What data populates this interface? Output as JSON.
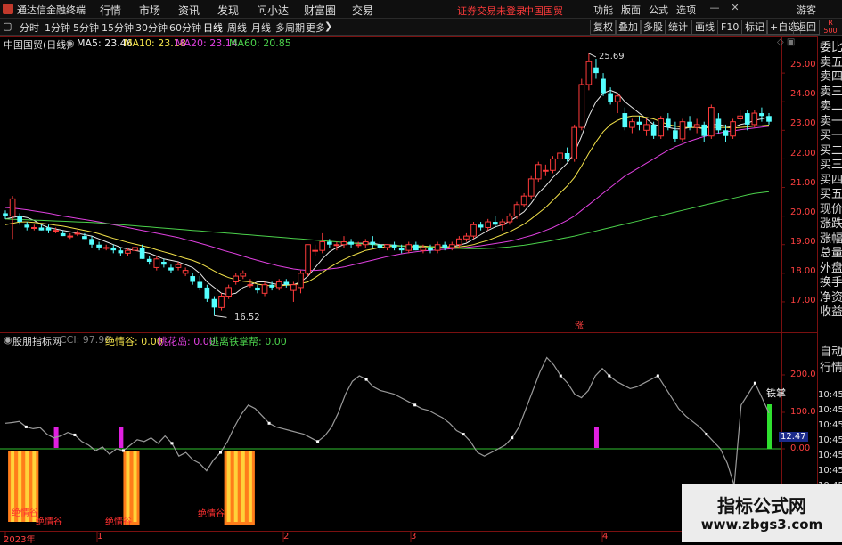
{
  "app": {
    "name": "通达信金融终端"
  },
  "menu": [
    "行情",
    "市场",
    "资讯",
    "发现",
    "问小达",
    "财富圈",
    "交易"
  ],
  "warning": {
    "login": "证券交易未登录",
    "stock": "中国国贸"
  },
  "right_menu": [
    "功能",
    "版面",
    "公式",
    "选项"
  ],
  "guest": "游客",
  "toolbar": {
    "periods": [
      "分时",
      "1分钟",
      "5分钟",
      "15分钟",
      "30分钟",
      "60分钟",
      "日线",
      "周线",
      "月线",
      "多周期",
      "更多"
    ],
    "active": "日线",
    "right": [
      "复权",
      "叠加",
      "多股",
      "统计",
      "画线",
      "F10",
      "标记",
      "+自选",
      "返回"
    ]
  },
  "main_chart": {
    "title": "中国国贸(日线)",
    "ma": [
      {
        "label": "MA5: 23.46",
        "color": "#e8e8e8"
      },
      {
        "label": "MA10: 23.18",
        "color": "#f3e24a"
      },
      {
        "label": "MA20: 23.14",
        "color": "#e040e0"
      },
      {
        "label": "MA60: 20.85",
        "color": "#4bd14b"
      }
    ],
    "high_label": "25.69",
    "low_label": "16.52",
    "badge": "涨",
    "yticks": [
      "25.00",
      "24.00",
      "23.00",
      "22.00",
      "21.00",
      "20.00",
      "19.00",
      "18.00",
      "17.00"
    ]
  },
  "indicator": {
    "name": "股朋指标网",
    "values": [
      {
        "label": "CCI: 97.90",
        "color": "#808080"
      },
      {
        "label": "绝情谷: 0.00",
        "color": "#f3e24a"
      },
      {
        "label": "桃花岛: 0.00",
        "color": "#e040e0"
      },
      {
        "label": "逃离铁掌帮: 0.00",
        "color": "#4bd14b"
      }
    ],
    "yticks": [
      "200.0",
      "100.0",
      "0.00"
    ],
    "current_value": "12.47",
    "side_label": "铁掌",
    "signal_label": "绝情谷"
  },
  "date_axis": [
    "2023年",
    "1",
    "2",
    "3",
    "4"
  ],
  "right_panel": [
    "委比",
    "卖五",
    "卖四",
    "卖三",
    "卖二",
    "卖一",
    "买一",
    "买二",
    "买三",
    "买四",
    "买五",
    "现价",
    "涨跌",
    "涨幅",
    "总量",
    "外盘",
    "换手",
    "净资",
    "收益"
  ],
  "right_panel_bottom": [
    "自动",
    "行情"
  ],
  "times": [
    "10:45",
    "10:45",
    "10:45",
    "10:45",
    "10:45",
    "10:45",
    "10:45"
  ],
  "r_badge": "R",
  "r_badge_num": "500",
  "watermark": {
    "line1": "指标公式网",
    "line2": "www.zbgs3.com"
  },
  "chart_data": {
    "type": "candlestick",
    "ylim": [
      16.5,
      26.0
    ],
    "colors": {
      "up": "#ff3b3b",
      "down": "#54ffff"
    },
    "candles": [
      [
        20.1,
        20.2,
        19.9,
        20.0
      ],
      [
        20.0,
        20.7,
        19.2,
        20.6
      ],
      [
        20.0,
        20.1,
        19.7,
        19.8
      ],
      [
        19.7,
        19.8,
        19.5,
        19.6
      ],
      [
        19.6,
        19.7,
        19.5,
        19.6
      ],
      [
        19.6,
        19.7,
        19.5,
        19.5
      ],
      [
        19.6,
        19.7,
        19.4,
        19.5
      ],
      [
        19.5,
        19.6,
        19.4,
        19.5
      ],
      [
        19.4,
        19.5,
        19.3,
        19.3
      ],
      [
        19.3,
        19.4,
        19.2,
        19.3
      ],
      [
        19.4,
        19.5,
        19.3,
        19.4
      ],
      [
        19.3,
        19.4,
        19.2,
        19.2
      ],
      [
        19.2,
        19.3,
        18.9,
        19.0
      ],
      [
        19.0,
        19.1,
        18.8,
        18.9
      ],
      [
        18.9,
        19.0,
        18.8,
        18.9
      ],
      [
        18.9,
        19.0,
        18.7,
        18.8
      ],
      [
        18.8,
        18.9,
        18.6,
        18.7
      ],
      [
        18.7,
        18.9,
        18.6,
        18.8
      ],
      [
        18.8,
        19.0,
        18.7,
        18.9
      ],
      [
        18.9,
        19.0,
        18.5,
        18.5
      ],
      [
        18.5,
        18.6,
        18.3,
        18.4
      ],
      [
        18.2,
        18.6,
        18.1,
        18.5
      ],
      [
        18.4,
        18.5,
        18.2,
        18.3
      ],
      [
        18.2,
        18.3,
        18.0,
        18.1
      ],
      [
        18.2,
        18.4,
        18.1,
        18.3
      ],
      [
        18.0,
        18.2,
        17.9,
        18.1
      ],
      [
        17.9,
        18.0,
        17.6,
        17.7
      ],
      [
        17.7,
        17.9,
        17.4,
        17.5
      ],
      [
        17.5,
        17.6,
        17.0,
        17.1
      ],
      [
        17.1,
        17.2,
        16.52,
        16.8
      ],
      [
        16.8,
        17.3,
        16.7,
        17.2
      ],
      [
        17.2,
        17.6,
        17.1,
        17.5
      ],
      [
        17.7,
        18.0,
        17.6,
        17.9
      ],
      [
        17.9,
        18.1,
        17.8,
        18.0
      ],
      [
        17.6,
        17.8,
        17.5,
        17.6
      ],
      [
        17.5,
        17.6,
        17.3,
        17.4
      ],
      [
        17.3,
        17.7,
        17.2,
        17.6
      ],
      [
        17.6,
        17.7,
        17.4,
        17.5
      ],
      [
        17.5,
        17.8,
        17.4,
        17.7
      ],
      [
        17.7,
        17.8,
        17.5,
        17.6
      ],
      [
        17.4,
        17.7,
        17.0,
        17.6
      ],
      [
        17.5,
        18.1,
        17.3,
        18.0
      ],
      [
        18.0,
        19.0,
        17.9,
        19.0
      ],
      [
        18.8,
        19.0,
        18.6,
        18.8
      ],
      [
        18.8,
        19.4,
        18.7,
        19.1
      ],
      [
        19.1,
        19.2,
        18.9,
        19.0
      ],
      [
        19.0,
        19.1,
        18.8,
        19.0
      ],
      [
        19.0,
        19.3,
        18.9,
        19.1
      ],
      [
        19.1,
        19.2,
        18.9,
        19.0
      ],
      [
        19.0,
        19.1,
        18.9,
        19.0
      ],
      [
        19.0,
        19.2,
        18.9,
        19.1
      ],
      [
        19.1,
        19.3,
        18.9,
        19.0
      ],
      [
        19.0,
        19.1,
        18.8,
        18.9
      ],
      [
        18.9,
        19.0,
        18.8,
        19.0
      ],
      [
        19.0,
        19.1,
        18.8,
        18.9
      ],
      [
        18.9,
        19.0,
        18.7,
        18.8
      ],
      [
        18.8,
        19.1,
        18.7,
        19.0
      ],
      [
        19.0,
        19.1,
        18.8,
        18.8
      ],
      [
        18.8,
        19.0,
        18.7,
        18.9
      ],
      [
        18.9,
        19.0,
        18.7,
        18.8
      ],
      [
        18.8,
        19.1,
        18.7,
        19.0
      ],
      [
        19.0,
        19.1,
        18.8,
        18.9
      ],
      [
        18.9,
        19.1,
        18.8,
        19.0
      ],
      [
        19.0,
        19.3,
        18.9,
        19.2
      ],
      [
        19.2,
        19.4,
        19.1,
        19.3
      ],
      [
        19.3,
        19.8,
        19.2,
        19.7
      ],
      [
        19.7,
        19.8,
        19.5,
        19.6
      ],
      [
        19.6,
        19.9,
        19.5,
        19.8
      ],
      [
        19.8,
        20.0,
        19.6,
        19.7
      ],
      [
        19.7,
        19.9,
        19.5,
        19.8
      ],
      [
        19.8,
        20.1,
        19.7,
        20.0
      ],
      [
        20.0,
        20.5,
        19.9,
        20.4
      ],
      [
        20.4,
        20.8,
        20.3,
        20.7
      ],
      [
        20.7,
        21.4,
        20.6,
        21.3
      ],
      [
        21.3,
        21.9,
        21.2,
        21.8
      ],
      [
        21.6,
        21.8,
        21.4,
        21.6
      ],
      [
        21.6,
        22.1,
        21.5,
        22.0
      ],
      [
        22.0,
        22.3,
        21.8,
        22.2
      ],
      [
        22.2,
        22.4,
        21.9,
        22.0
      ],
      [
        22.0,
        23.2,
        21.9,
        23.1
      ],
      [
        23.1,
        24.8,
        23.0,
        24.6
      ],
      [
        24.6,
        25.69,
        24.4,
        25.4
      ],
      [
        25.2,
        25.5,
        24.8,
        25.0
      ],
      [
        24.8,
        25.0,
        24.2,
        24.3
      ],
      [
        24.3,
        24.5,
        23.9,
        24.0
      ],
      [
        24.0,
        24.3,
        23.6,
        24.2
      ],
      [
        23.6,
        23.8,
        23.0,
        23.1
      ],
      [
        23.1,
        23.4,
        22.9,
        23.3
      ],
      [
        23.3,
        23.5,
        23.0,
        23.2
      ],
      [
        23.0,
        23.4,
        22.8,
        23.2
      ],
      [
        23.2,
        23.3,
        22.7,
        22.8
      ],
      [
        22.8,
        23.5,
        22.7,
        23.4
      ],
      [
        23.4,
        23.6,
        23.0,
        23.1
      ],
      [
        23.0,
        23.3,
        22.6,
        22.7
      ],
      [
        22.7,
        23.4,
        22.6,
        23.3
      ],
      [
        23.3,
        23.5,
        23.0,
        23.1
      ],
      [
        23.1,
        23.4,
        22.9,
        23.2
      ],
      [
        23.2,
        23.3,
        22.6,
        22.8
      ],
      [
        22.8,
        23.9,
        22.7,
        23.8
      ],
      [
        23.4,
        23.6,
        22.9,
        23.0
      ],
      [
        23.0,
        23.2,
        22.6,
        22.8
      ],
      [
        22.8,
        23.4,
        22.7,
        23.3
      ],
      [
        23.4,
        23.7,
        23.3,
        23.5
      ],
      [
        23.6,
        23.7,
        23.0,
        23.2
      ],
      [
        23.2,
        23.7,
        23.1,
        23.6
      ],
      [
        23.6,
        23.8,
        23.3,
        23.5
      ],
      [
        23.5,
        23.6,
        23.2,
        23.3
      ]
    ],
    "ma_lines": [
      {
        "name": "MA5",
        "values": [
          19.9,
          19.95,
          20.0,
          19.95,
          19.85,
          19.7,
          19.6,
          19.55,
          19.5,
          19.45,
          19.4,
          19.35,
          19.3,
          19.2,
          19.1,
          19.0,
          18.9,
          18.85,
          18.8,
          18.75,
          18.7,
          18.6,
          18.5,
          18.45,
          18.4,
          18.3,
          18.2,
          18.0,
          17.7,
          17.5,
          17.3,
          17.25,
          17.3,
          17.5,
          17.6,
          17.7,
          17.7,
          17.65,
          17.6,
          17.6,
          17.6,
          17.7,
          17.9,
          18.2,
          18.5,
          18.75,
          18.9,
          19.0,
          19.05,
          19.05,
          19.05,
          19.05,
          19.0,
          19.0,
          18.98,
          18.95,
          18.92,
          18.92,
          18.9,
          18.88,
          18.9,
          18.92,
          18.93,
          18.98,
          19.05,
          19.2,
          19.35,
          19.5,
          19.62,
          19.7,
          19.82,
          19.98,
          20.15,
          20.45,
          20.8,
          21.05,
          21.35,
          21.6,
          21.85,
          22.2,
          22.8,
          23.5,
          24.0,
          24.3,
          24.4,
          24.3,
          24.0,
          23.8,
          23.6,
          23.4,
          23.2,
          23.15,
          23.1,
          23.05,
          23.05,
          23.1,
          23.1,
          23.05,
          23.2,
          23.2,
          23.15,
          23.1,
          23.2,
          23.25,
          23.35,
          23.4,
          23.46
        ]
      },
      {
        "name": "MA10",
        "values": [
          19.7,
          19.75,
          19.8,
          19.8,
          19.78,
          19.75,
          19.72,
          19.68,
          19.65,
          19.6,
          19.55,
          19.5,
          19.45,
          19.38,
          19.3,
          19.22,
          19.15,
          19.08,
          19.02,
          18.96,
          18.9,
          18.82,
          18.75,
          18.68,
          18.6,
          18.52,
          18.45,
          18.35,
          18.22,
          18.08,
          17.95,
          17.85,
          17.78,
          17.72,
          17.7,
          17.62,
          17.58,
          17.56,
          17.56,
          17.58,
          17.6,
          17.64,
          17.7,
          17.85,
          18.02,
          18.2,
          18.35,
          18.48,
          18.6,
          18.7,
          18.8,
          18.85,
          18.9,
          18.92,
          18.95,
          18.95,
          18.95,
          18.95,
          18.95,
          18.93,
          18.92,
          18.92,
          18.92,
          18.92,
          18.95,
          19.0,
          19.08,
          19.15,
          19.25,
          19.35,
          19.45,
          19.58,
          19.72,
          19.9,
          20.1,
          20.3,
          20.55,
          20.8,
          21.05,
          21.35,
          21.75,
          22.2,
          22.6,
          22.95,
          23.2,
          23.35,
          23.45,
          23.5,
          23.5,
          23.45,
          23.4,
          23.3,
          23.2,
          23.15,
          23.1,
          23.1,
          23.1,
          23.08,
          23.1,
          23.1,
          23.1,
          23.08,
          23.1,
          23.12,
          23.15,
          23.16,
          23.18
        ]
      },
      {
        "name": "MA20",
        "values": [
          20.3,
          20.28,
          20.25,
          20.22,
          20.18,
          20.14,
          20.1,
          20.05,
          20.0,
          19.96,
          19.92,
          19.88,
          19.84,
          19.8,
          19.75,
          19.7,
          19.65,
          19.6,
          19.55,
          19.5,
          19.45,
          19.4,
          19.35,
          19.3,
          19.25,
          19.18,
          19.12,
          19.05,
          18.98,
          18.9,
          18.82,
          18.75,
          18.68,
          18.6,
          18.52,
          18.45,
          18.38,
          18.32,
          18.25,
          18.2,
          18.15,
          18.12,
          18.1,
          18.1,
          18.12,
          18.15,
          18.18,
          18.22,
          18.28,
          18.34,
          18.4,
          18.46,
          18.52,
          18.58,
          18.63,
          18.68,
          18.72,
          18.75,
          18.78,
          18.8,
          18.82,
          18.84,
          18.86,
          18.88,
          18.9,
          18.93,
          18.96,
          19.0,
          19.04,
          19.08,
          19.12,
          19.18,
          19.25,
          19.32,
          19.4,
          19.5,
          19.6,
          19.72,
          19.85,
          20.0,
          20.2,
          20.4,
          20.6,
          20.8,
          21.0,
          21.2,
          21.4,
          21.55,
          21.7,
          21.85,
          22.0,
          22.15,
          22.3,
          22.42,
          22.52,
          22.62,
          22.7,
          22.78,
          22.84,
          22.9,
          22.95,
          22.98,
          23.02,
          23.05,
          23.08,
          23.11,
          23.14
        ]
      },
      {
        "name": "MA60",
        "values": [
          19.9,
          19.89,
          19.88,
          19.87,
          19.86,
          19.85,
          19.84,
          19.83,
          19.82,
          19.81,
          19.8,
          19.79,
          19.78,
          19.76,
          19.74,
          19.72,
          19.7,
          19.68,
          19.66,
          19.64,
          19.62,
          19.6,
          19.58,
          19.56,
          19.54,
          19.52,
          19.5,
          19.48,
          19.46,
          19.44,
          19.42,
          19.4,
          19.38,
          19.36,
          19.34,
          19.32,
          19.3,
          19.28,
          19.26,
          19.24,
          19.22,
          19.2,
          19.18,
          19.16,
          19.14,
          19.12,
          19.1,
          19.08,
          19.06,
          19.04,
          19.02,
          19.0,
          18.98,
          18.97,
          18.96,
          18.95,
          18.94,
          18.93,
          18.92,
          18.91,
          18.9,
          18.89,
          18.88,
          18.87,
          18.86,
          18.86,
          18.86,
          18.87,
          18.88,
          18.9,
          18.92,
          18.95,
          18.98,
          19.02,
          19.06,
          19.1,
          19.15,
          19.2,
          19.25,
          19.3,
          19.36,
          19.42,
          19.48,
          19.54,
          19.6,
          19.66,
          19.72,
          19.78,
          19.84,
          19.9,
          19.96,
          20.02,
          20.08,
          20.14,
          20.2,
          20.26,
          20.32,
          20.38,
          20.44,
          20.5,
          20.56,
          20.62,
          20.68,
          20.74,
          20.79,
          20.82,
          20.85
        ]
      }
    ],
    "cci": [
      70,
      72,
      75,
      60,
      55,
      58,
      40,
      30,
      35,
      45,
      38,
      20,
      10,
      -5,
      5,
      -15,
      0,
      -5,
      10,
      25,
      20,
      30,
      15,
      35,
      15,
      -20,
      -10,
      -30,
      -40,
      -60,
      -30,
      -10,
      20,
      60,
      95,
      120,
      110,
      90,
      70,
      60,
      55,
      50,
      45,
      40,
      30,
      20,
      35,
      60,
      100,
      150,
      185,
      200,
      190,
      170,
      160,
      155,
      150,
      140,
      130,
      120,
      110,
      105,
      95,
      85,
      70,
      50,
      40,
      20,
      -10,
      -20,
      -10,
      0,
      10,
      30,
      60,
      110,
      160,
      210,
      250,
      230,
      200,
      180,
      150,
      140,
      160,
      200,
      220,
      200,
      185,
      175,
      165,
      170,
      180,
      190,
      200,
      170,
      140,
      110,
      90,
      75,
      60,
      40,
      20,
      0,
      -40,
      -100,
      120,
      150,
      180,
      140,
      97.9
    ],
    "signals": {
      "jueqinggu_idx": [
        1,
        2,
        3,
        4,
        17,
        18,
        31,
        32,
        33,
        34
      ],
      "taohuadao_idx": [
        7,
        16,
        82
      ],
      "green_idx": [
        106
      ]
    }
  }
}
